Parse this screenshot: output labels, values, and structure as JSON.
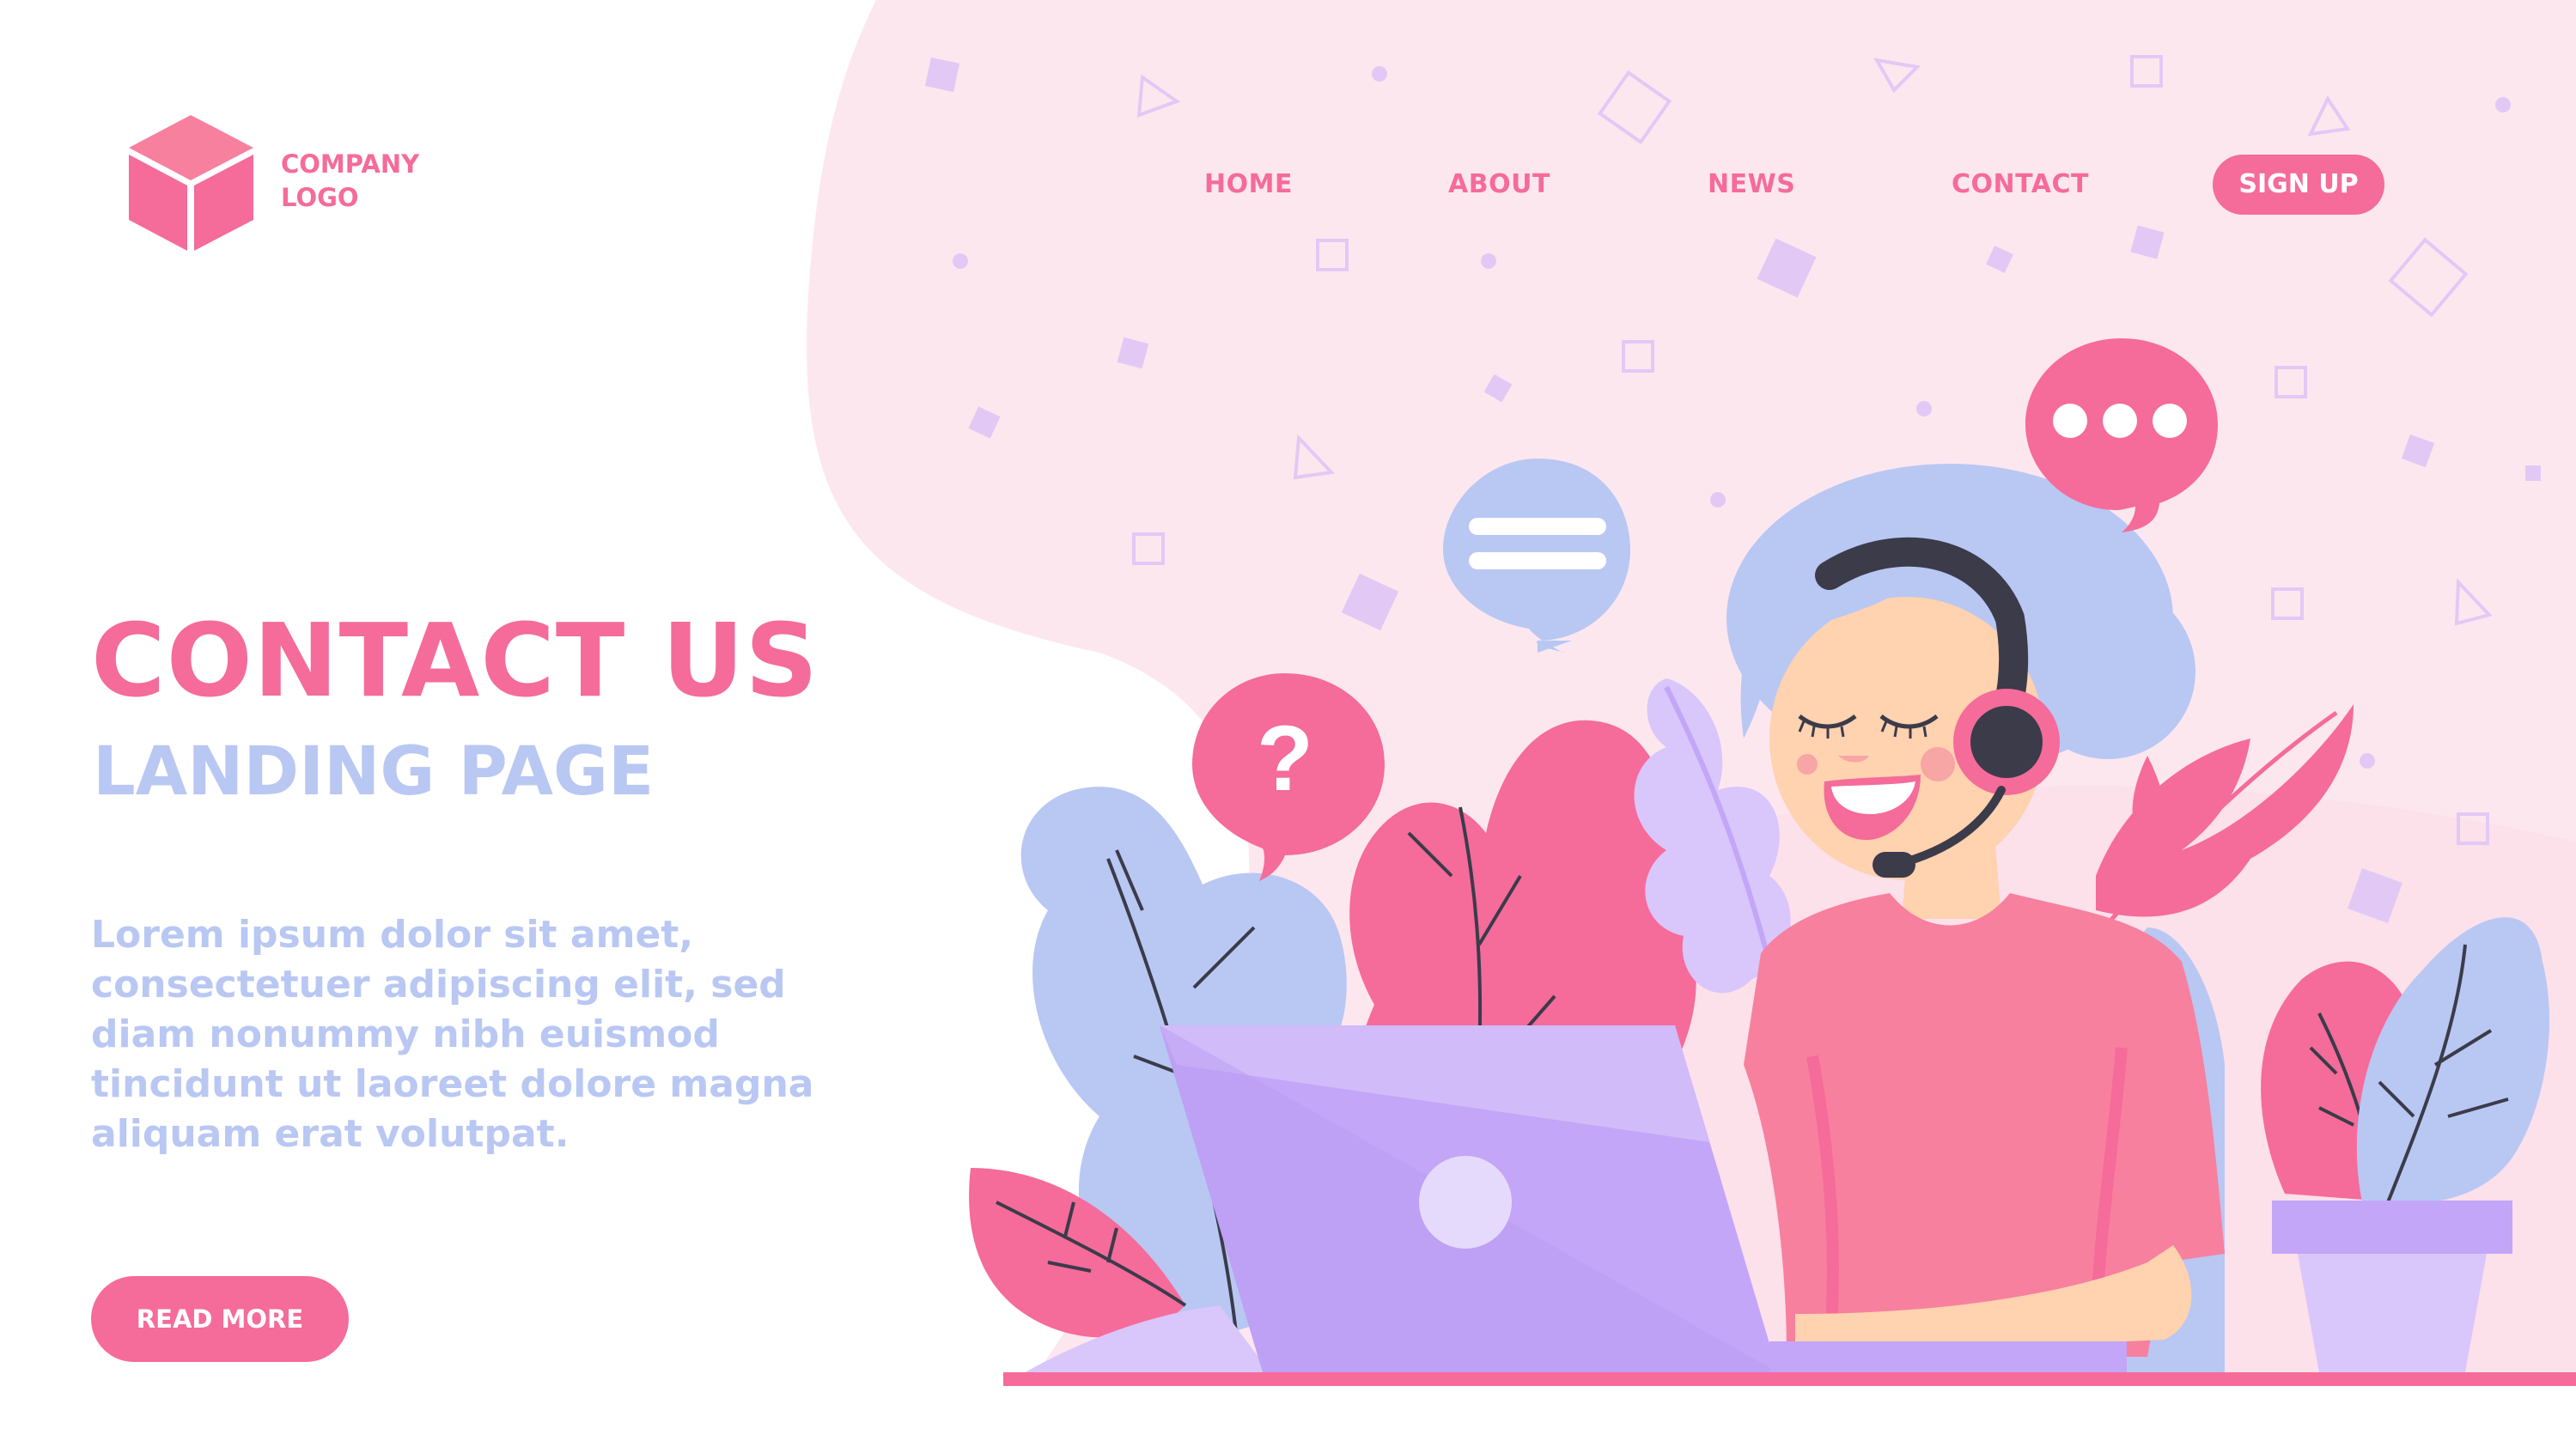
{
  "logo": {
    "line1": "COMPANY",
    "line2": "LOGO",
    "icon": "cube-icon"
  },
  "nav": {
    "home": "HOME",
    "about": "ABOUT",
    "news": "NEWS",
    "contact": "CONTACT",
    "signup": "SIGN UP"
  },
  "hero": {
    "title": "CONTACT US",
    "subtitle": "LANDING PAGE",
    "body": "Lorem ipsum dolor sit amet, consectetuer adipiscing elit, sed diam nonummy nibh euismod tincidunt ut laoreet dolore magna aliquam erat volutpat.",
    "cta": "READ MORE"
  },
  "illustration": {
    "question_mark": "?",
    "icons": [
      "chat-bubble-question-icon",
      "chat-bubble-lines-icon",
      "chat-bubble-dots-icon",
      "headset-icon",
      "laptop-icon"
    ]
  },
  "colors": {
    "accent": "#f56b9a",
    "secondary": "#b9c7f3",
    "background_blob": "#fde7ef",
    "laptop": "#c3a6f7"
  }
}
